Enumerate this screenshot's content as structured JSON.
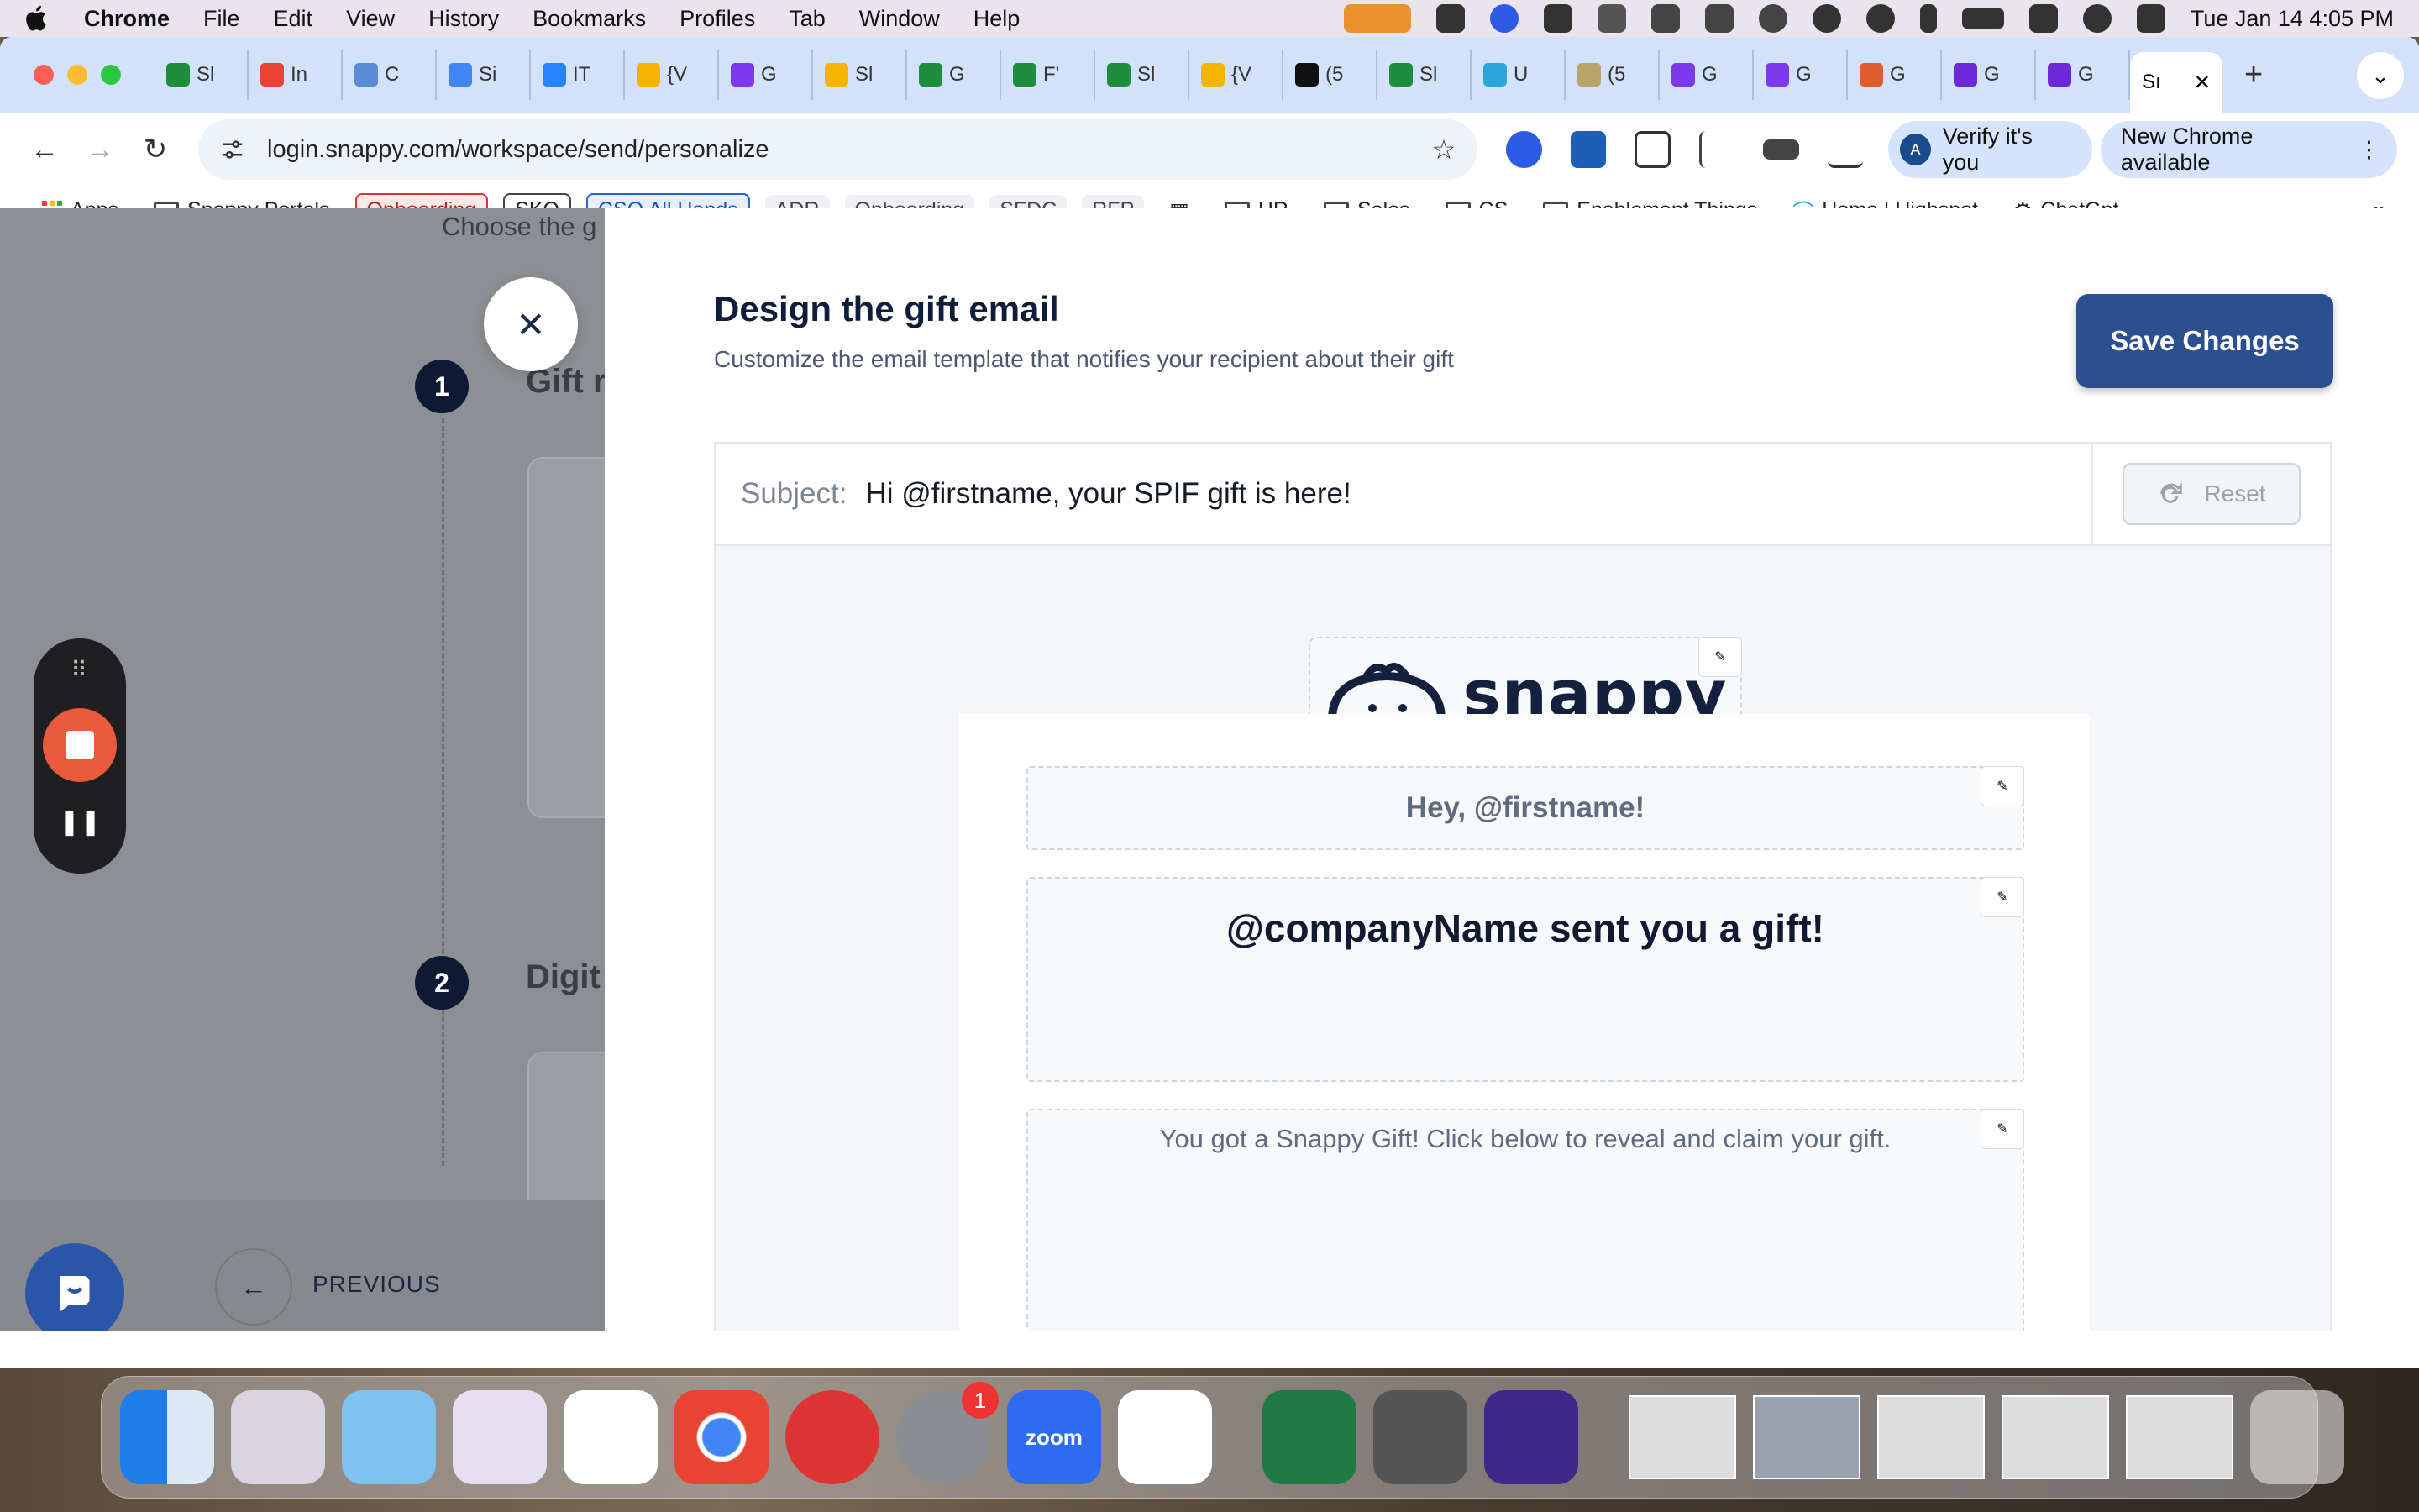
{
  "menubar": {
    "app_name": "Chrome",
    "items": [
      "File",
      "Edit",
      "View",
      "History",
      "Bookmarks",
      "Profiles",
      "Tab",
      "Window",
      "Help"
    ],
    "clock": "Tue Jan 14  4:05 PM"
  },
  "tabs": {
    "mini": [
      {
        "label": "Sl",
        "color": "#1e8e3e"
      },
      {
        "label": "In",
        "color": "#ea4335"
      },
      {
        "label": "C",
        "color": "#5b8bd6"
      },
      {
        "label": "Si",
        "color": "#4285f4"
      },
      {
        "label": "IT",
        "color": "#2684ff"
      },
      {
        "label": "{V",
        "color": "#f4b400"
      },
      {
        "label": "G",
        "color": "#7c3aed"
      },
      {
        "label": "Sl",
        "color": "#f4b400"
      },
      {
        "label": "G",
        "color": "#1e8e3e"
      },
      {
        "label": "F'",
        "color": "#1e8e3e"
      },
      {
        "label": "Sl",
        "color": "#1e8e3e"
      },
      {
        "label": "{V",
        "color": "#f4b400"
      },
      {
        "label": "(5",
        "color": "#111111"
      },
      {
        "label": "Sl",
        "color": "#1e8e3e"
      },
      {
        "label": "U",
        "color": "#2aa7d8"
      },
      {
        "label": "(5",
        "color": "#b8a36a"
      },
      {
        "label": "G",
        "color": "#7c3aed"
      },
      {
        "label": "G",
        "color": "#7c3aed"
      },
      {
        "label": "G",
        "color": "#e05d2f"
      },
      {
        "label": "G",
        "color": "#6d28d9"
      },
      {
        "label": "G",
        "color": "#6d28d9"
      }
    ],
    "active_label": "Sı"
  },
  "toolbar": {
    "url": "login.snappy.com/workspace/send/personalize",
    "verify_label": "Verify it's you",
    "new_chrome_label": "New Chrome available"
  },
  "bookmarks": {
    "apps": "Apps",
    "snappy_portals": "Snappy Portals",
    "onboarding_red": "Onboarding",
    "sko": "SKO",
    "cso": "CSO All Hands",
    "adr": "ADR",
    "onboarding_gray": "Onboarding",
    "sfdc": "SFDC",
    "rfp": "RFP",
    "hr": "HR",
    "sales": "Sales",
    "cs": "CS",
    "enablement": "Enablement Things",
    "highspot": "Home | Highspot",
    "chatgpt": "ChatGpt"
  },
  "background_page": {
    "choose_text": "Choose the g",
    "step1_num": "1",
    "step1_title": "Gift r",
    "step2_num": "2",
    "step2_title": "Digit",
    "previous": "PREVIOUS"
  },
  "drawer": {
    "title": "Design the gift email",
    "subtitle": "Customize the email template that notifies your recipient about their gift",
    "save_label": "Save Changes",
    "subject_label": "Subject:",
    "subject_value": "Hi @firstname, your SPIF gift is here!",
    "reset_label": "Reset",
    "logo_text": "snappy",
    "greeting": "Hey, @firstname!",
    "headline": "@companyName sent you a gift!",
    "body": "You got a Snappy Gift! Click below to reveal and claim your gift."
  },
  "dock": {
    "zoom_label": "zoom",
    "settings_badge": "1"
  },
  "colors": {
    "accent": "#2c4f8f",
    "navy": "#0f1d3d",
    "record": "#ea5a3c"
  }
}
